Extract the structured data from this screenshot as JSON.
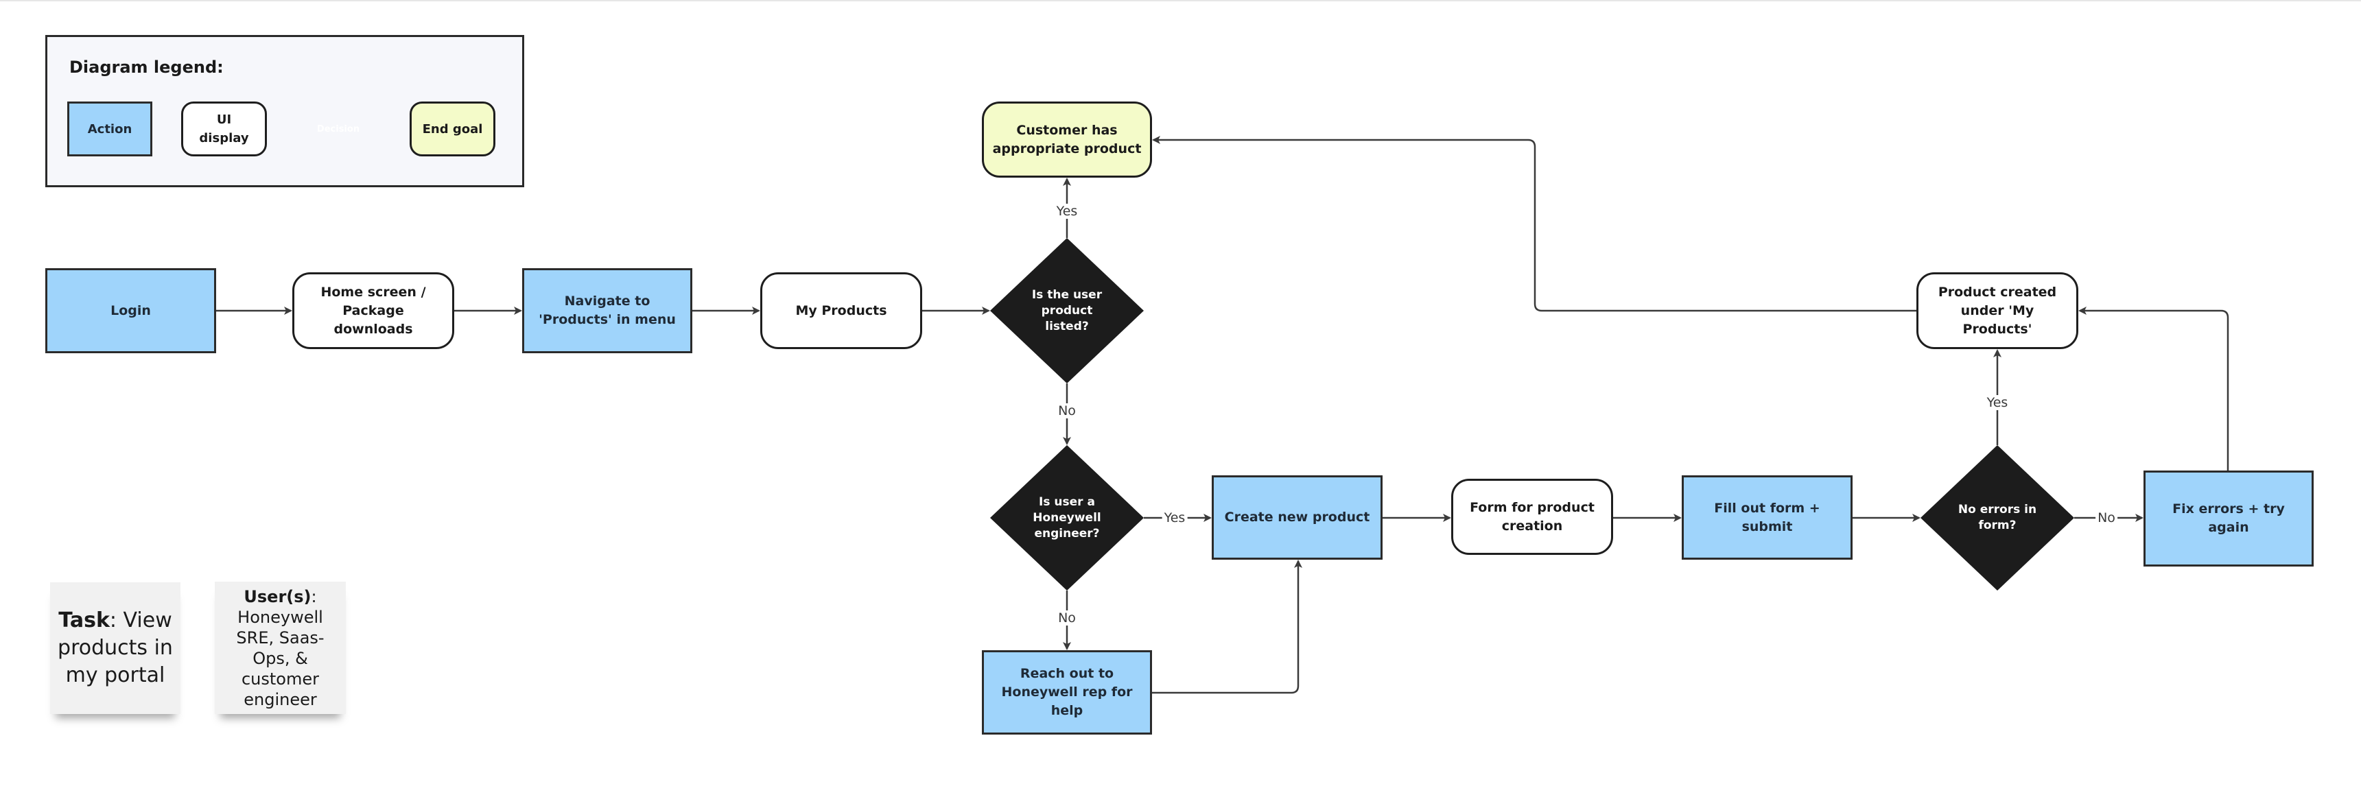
{
  "legend": {
    "title": "Diagram legend:",
    "items": [
      {
        "kind": "action",
        "label": "Action"
      },
      {
        "kind": "ui",
        "label": "UI display"
      },
      {
        "kind": "decision",
        "label": "Decision"
      },
      {
        "kind": "goal",
        "label": "End goal"
      }
    ]
  },
  "colors": {
    "action_fill": "#9fd4fb",
    "ui_fill": "#ffffff",
    "decision_fill": "#1c1c1c",
    "goal_fill": "#f4fbc9",
    "connector": "#3a3a3a"
  },
  "nodes": {
    "login": {
      "kind": "action",
      "label": "Login"
    },
    "home": {
      "kind": "ui",
      "label": "Home screen / Package downloads"
    },
    "navigate": {
      "kind": "action",
      "label": "Navigate to 'Products' in menu"
    },
    "my_products": {
      "kind": "ui",
      "label": "My Products"
    },
    "is_listed": {
      "kind": "decision",
      "label": "Is the user product listed?"
    },
    "customer_has": {
      "kind": "goal",
      "label": "Customer has appropriate product"
    },
    "is_engineer": {
      "kind": "decision",
      "label": "Is user a Honeywell engineer?"
    },
    "create_new": {
      "kind": "action",
      "label": "Create new product"
    },
    "reach_out": {
      "kind": "action",
      "label": "Reach out to Honeywell rep for help"
    },
    "form": {
      "kind": "ui",
      "label": "Form for product creation"
    },
    "fill_out": {
      "kind": "action",
      "label": "Fill out form + submit"
    },
    "no_errors": {
      "kind": "decision",
      "label": "No errors in form?"
    },
    "fix_errors": {
      "kind": "action",
      "label": "Fix errors + try again"
    },
    "product_created": {
      "kind": "ui",
      "label": "Product created under 'My Products'"
    }
  },
  "edges": [
    {
      "from": "login",
      "to": "home",
      "label": ""
    },
    {
      "from": "home",
      "to": "navigate",
      "label": ""
    },
    {
      "from": "navigate",
      "to": "my_products",
      "label": ""
    },
    {
      "from": "my_products",
      "to": "is_listed",
      "label": ""
    },
    {
      "from": "is_listed",
      "to": "customer_has",
      "label": "Yes"
    },
    {
      "from": "is_listed",
      "to": "is_engineer",
      "label": "No"
    },
    {
      "from": "is_engineer",
      "to": "create_new",
      "label": "Yes"
    },
    {
      "from": "is_engineer",
      "to": "reach_out",
      "label": "No"
    },
    {
      "from": "reach_out",
      "to": "create_new",
      "label": ""
    },
    {
      "from": "create_new",
      "to": "form",
      "label": ""
    },
    {
      "from": "form",
      "to": "fill_out",
      "label": ""
    },
    {
      "from": "fill_out",
      "to": "no_errors",
      "label": ""
    },
    {
      "from": "no_errors",
      "to": "fix_errors",
      "label": "No"
    },
    {
      "from": "no_errors",
      "to": "product_created",
      "label": "Yes"
    },
    {
      "from": "fix_errors",
      "to": "product_created",
      "label": ""
    },
    {
      "from": "product_created",
      "to": "customer_has",
      "label": ""
    }
  ],
  "edge_labels": {
    "yes": "Yes",
    "no": "No"
  },
  "notes": {
    "task": {
      "bold": "Task",
      "text": ": View products in my portal"
    },
    "users": {
      "bold": "User(s)",
      "text": ": Honeywell SRE, Saas-Ops, & customer engineer"
    }
  }
}
